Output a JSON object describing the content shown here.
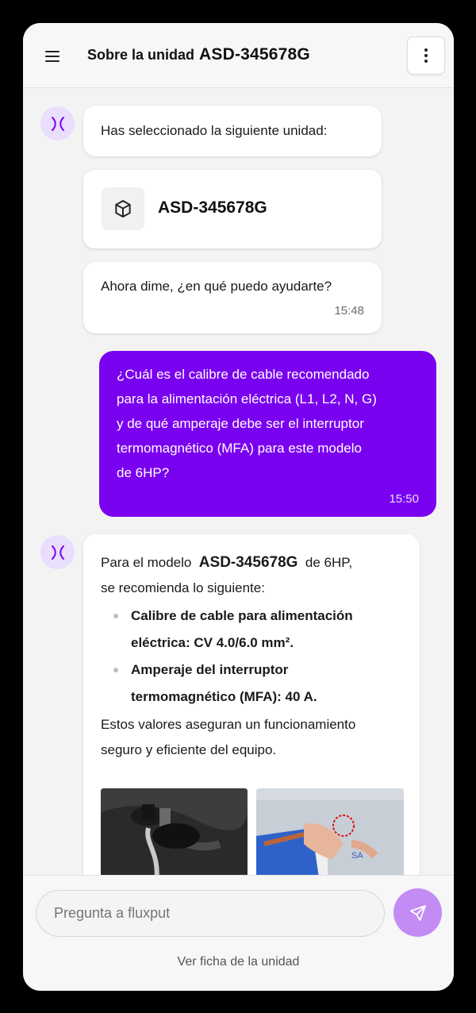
{
  "header": {
    "title": "Sobre la unidad",
    "unit": "ASD-345678G",
    "menu_icon": "hamburger-menu-icon",
    "more_icon": "more-vertical-icon"
  },
  "chat": {
    "assistant_intro": "Has seleccionado la siguiente unidad:",
    "unit_card": {
      "icon": "cube-icon",
      "name": "ASD-345678G"
    },
    "assistant_prompt": {
      "text": "Ahora dime, ¿en qué puedo ayudarte?",
      "time": "15:48"
    },
    "user_message": {
      "lines": [
        "¿Cuál es el calibre de cable recomendado",
        "para la alimentación eléctrica (L1, L2, N, G)",
        "y de qué amperaje debe ser el interruptor",
        "termomagnético (MFA) para este modelo",
        "de 6HP?"
      ],
      "time": "15:50"
    },
    "assistant_answer": {
      "intro_before": "Para el modelo",
      "model": "ASD-345678G",
      "intro_after": "de 6HP,",
      "intro_line2": "se recomienda lo siguiente:",
      "bullets": [
        {
          "line1": "Calibre de cable para alimentación",
          "line2": "eléctrica: CV 4.0/6.0 mm²."
        },
        {
          "line1": "Amperaje del interruptor",
          "line2": "termomagnético (MFA): 40 A."
        }
      ],
      "closing_line1": "Estos valores aseguran un funcionamiento",
      "closing_line2": "seguro y eficiente del equipo."
    }
  },
  "composer": {
    "placeholder": "Pregunta a fluxput",
    "send_icon": "send-icon",
    "link": "Ver ficha de la unidad"
  },
  "colors": {
    "accent": "#7a00f0",
    "send_button": "#c38cf5",
    "avatar_bg": "#e9defb"
  }
}
